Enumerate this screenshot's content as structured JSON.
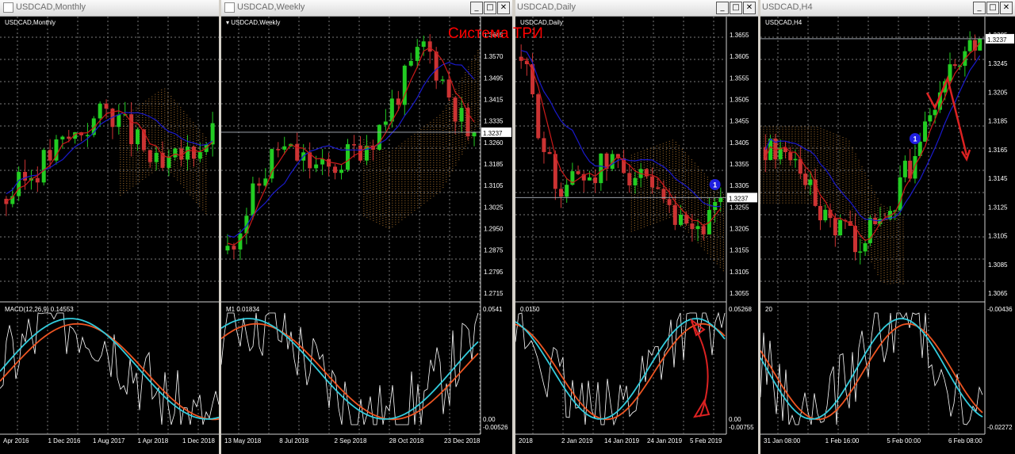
{
  "overlay_title": "Система ТРИ",
  "colors": {
    "up": "#22cc22",
    "down": "#cc3333",
    "kijun": "#1a1acc",
    "tenkan": "#cc1a1a",
    "cloud": "#cc8833",
    "cyan": "#33ccdd",
    "orange": "#ee5522",
    "white": "#ffffff",
    "grid": "#7a7a7a",
    "bg": "#000000",
    "annot": "#dd2222",
    "marker": "#1f1fe0"
  },
  "window_buttons": {
    "min": "_",
    "max": "□",
    "close": "✕"
  },
  "windows": [
    {
      "title": "USDCAD,Monthly",
      "chart_label": "USDCAD,Monthly",
      "osc_label": "MACD(12,26,9) 0.14553",
      "price_ticks": [],
      "osc_ticks": [],
      "time_ticks": [
        "Apr 2016",
        "1 Dec 2016",
        "1 Aug 2017",
        "1 Apr 2018",
        "1 Dec 2018"
      ],
      "price_range": [
        1.2,
        1.47
      ],
      "current_price": ""
    },
    {
      "title": "USDCAD,Weekly",
      "chart_label": "USDCAD,Weekly",
      "osc_label": "M1 0.01834",
      "price_ticks": [
        "1.3645",
        "1.3570",
        "1.3495",
        "1.3415",
        "1.3335",
        "1.3260",
        "1.3185",
        "1.3105",
        "1.3025",
        "1.2950",
        "1.2875",
        "1.2795",
        "1.2715"
      ],
      "osc_ticks": [
        "0.0541",
        "0.00",
        "-0.00526"
      ],
      "time_ticks": [
        "13 May 2018",
        "8 Jul 2018",
        "2 Sep 2018",
        "28 Oct 2018",
        "23 Dec 2018"
      ],
      "price_range": [
        1.2715,
        1.368
      ],
      "current_price": "1.3237"
    },
    {
      "title": "USDCAD,Daily",
      "chart_label": "USDCAD,Daily",
      "osc_label": "0.0150",
      "price_ticks": [
        "1.3655",
        "1.3605",
        "1.3555",
        "1.3505",
        "1.3455",
        "1.3405",
        "1.3355",
        "1.3305",
        "1.3255",
        "1.3205",
        "1.3155",
        "1.3105",
        "1.3055"
      ],
      "osc_ticks": [
        "0.05268",
        "0.00",
        "-0.00755"
      ],
      "time_ticks": [
        "2018",
        "2 Jan 2019",
        "14 Jan 2019",
        "24 Jan 2019",
        "5 Feb 2019"
      ],
      "price_range": [
        1.3055,
        1.368
      ],
      "current_price": "1.3237",
      "marker": "1"
    },
    {
      "title": "USDCAD,H4",
      "chart_label": "USDCAD,H4",
      "osc_label": "20",
      "price_ticks": [
        "1.3285",
        "1.3245",
        "1.3205",
        "1.3185",
        "1.3165",
        "1.3145",
        "1.3125",
        "1.3105",
        "1.3085",
        "1.3065"
      ],
      "osc_ticks": [
        "-0.00436",
        "-0.02272"
      ],
      "time_ticks": [
        "31 Jan 08:00",
        "1 Feb 16:00",
        "5 Feb 00:00",
        "6 Feb 08:00"
      ],
      "price_range": [
        1.3055,
        1.33
      ],
      "current_price": "1.3237",
      "marker": "1"
    }
  ]
}
